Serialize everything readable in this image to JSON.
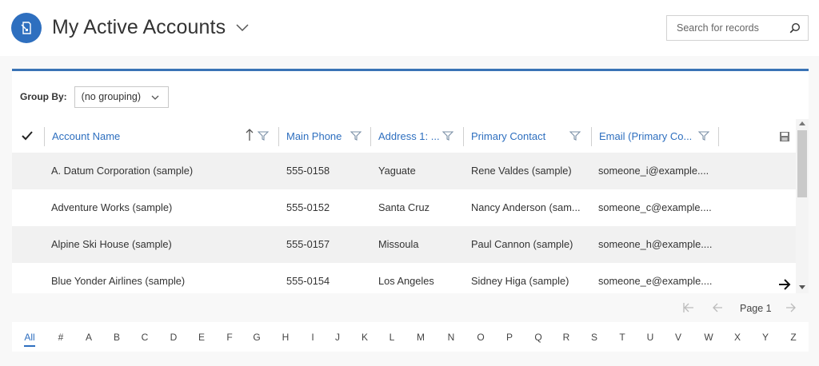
{
  "header": {
    "title": "My Active Accounts",
    "search_placeholder": "Search for records"
  },
  "groupby": {
    "label": "Group By:",
    "value": "(no grouping)"
  },
  "columns": [
    {
      "label": "Account Name"
    },
    {
      "label": "Main Phone"
    },
    {
      "label": "Address 1: ..."
    },
    {
      "label": "Primary Contact"
    },
    {
      "label": "Email (Primary Co..."
    }
  ],
  "rows": [
    {
      "name": "A. Datum Corporation (sample)",
      "phone": "555-0158",
      "city": "Yaguate",
      "contact": "Rene Valdes (sample)",
      "email": "someone_i@example...."
    },
    {
      "name": "Adventure Works (sample)",
      "phone": "555-0152",
      "city": "Santa Cruz",
      "contact": "Nancy Anderson (sam...",
      "email": "someone_c@example...."
    },
    {
      "name": "Alpine Ski House (sample)",
      "phone": "555-0157",
      "city": "Missoula",
      "contact": "Paul Cannon (sample)",
      "email": "someone_h@example...."
    },
    {
      "name": "Blue Yonder Airlines (sample)",
      "phone": "555-0154",
      "city": "Los Angeles",
      "contact": "Sidney Higa (sample)",
      "email": "someone_e@example...."
    }
  ],
  "pager": {
    "page_label": "Page 1"
  },
  "alphabet": [
    "All",
    "#",
    "A",
    "B",
    "C",
    "D",
    "E",
    "F",
    "G",
    "H",
    "I",
    "J",
    "K",
    "L",
    "M",
    "N",
    "O",
    "P",
    "Q",
    "R",
    "S",
    "T",
    "U",
    "V",
    "W",
    "X",
    "Y",
    "Z"
  ],
  "colors": {
    "accent": "#2e6fbf",
    "alt_row": "#f1f1f1"
  }
}
